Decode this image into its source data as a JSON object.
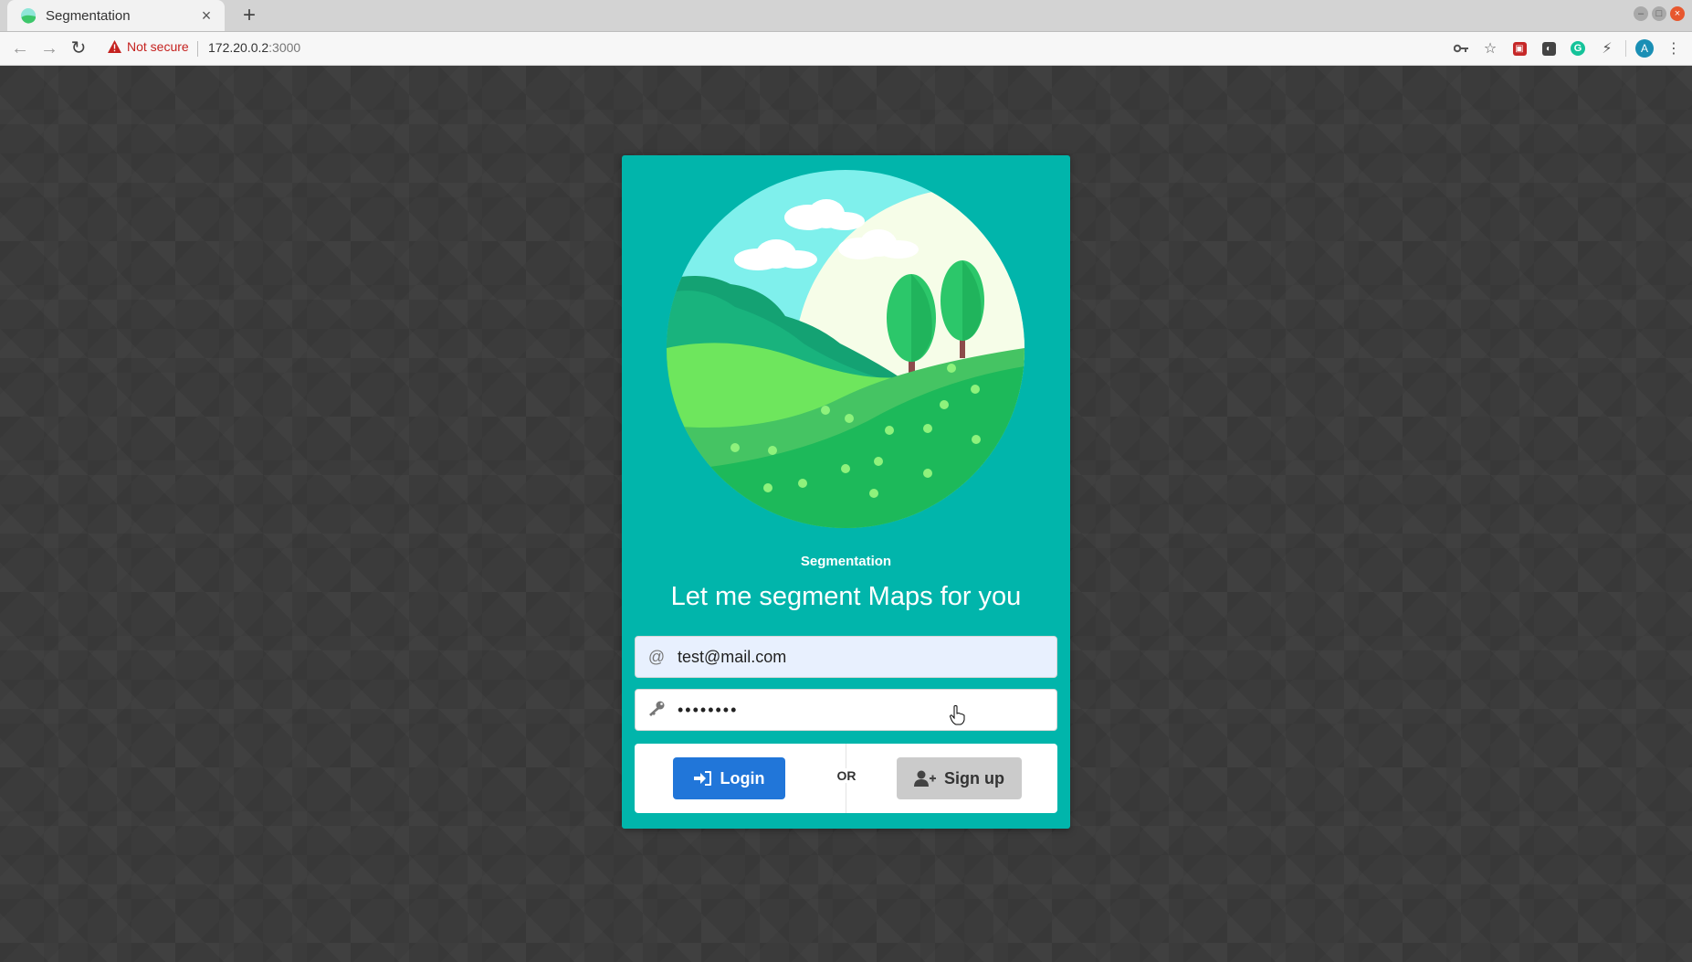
{
  "browser": {
    "tab": {
      "title": "Segmentation",
      "close_icon": "close-icon"
    },
    "new_tab_label": "+",
    "window_controls": [
      "minimize-icon",
      "maximize-icon",
      "close-icon"
    ],
    "address_bar": {
      "security_label": "Not secure",
      "url_host": "172.20.0.2",
      "url_port": ":3000"
    },
    "toolbar_icons": [
      "key-icon",
      "star-icon",
      "extension-icon",
      "extension-icon",
      "grammarly-icon",
      "extension-icon",
      "profile-avatar-icon",
      "menu-icon"
    ],
    "profile_initial": "A"
  },
  "login_card": {
    "brand": "Segmentation",
    "tagline": "Let me segment Maps for you",
    "email": {
      "value": "test@mail.com",
      "icon": "at-icon"
    },
    "password": {
      "masked_value": "••••••••",
      "icon": "key-icon"
    },
    "login_button": "Login",
    "or_label": "OR",
    "signup_button": "Sign up",
    "colors": {
      "card": "#01b5ab",
      "login": "#2176d9",
      "signup": "#cbcbcb"
    }
  }
}
